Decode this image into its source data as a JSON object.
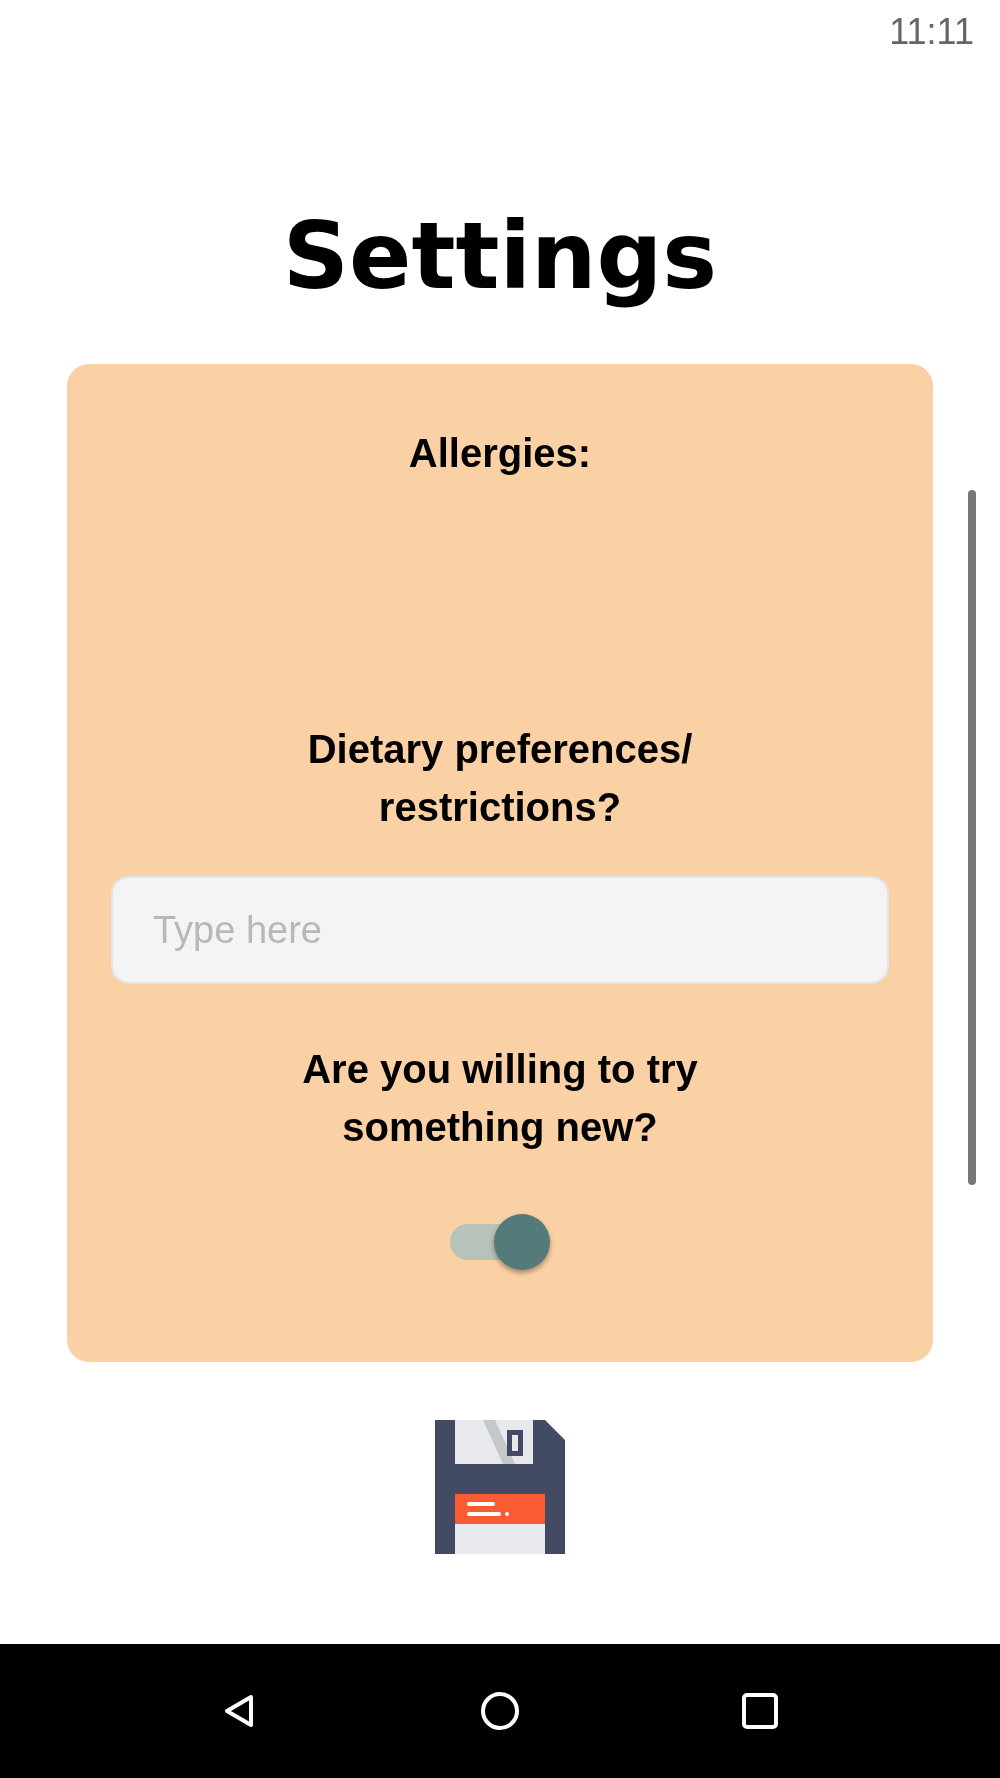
{
  "status_bar": {
    "time": "11:11"
  },
  "title": "Settings",
  "card": {
    "sections": [
      {
        "kind": "label",
        "text": "Allergies:"
      },
      {
        "kind": "label",
        "text": "Dietary preferences/\nrestrictions?"
      },
      {
        "kind": "field",
        "placeholder": "Type here"
      },
      {
        "kind": "label",
        "text": "Are you willing to try\nsomething new?"
      },
      {
        "kind": "toggle",
        "on": true
      }
    ]
  }
}
